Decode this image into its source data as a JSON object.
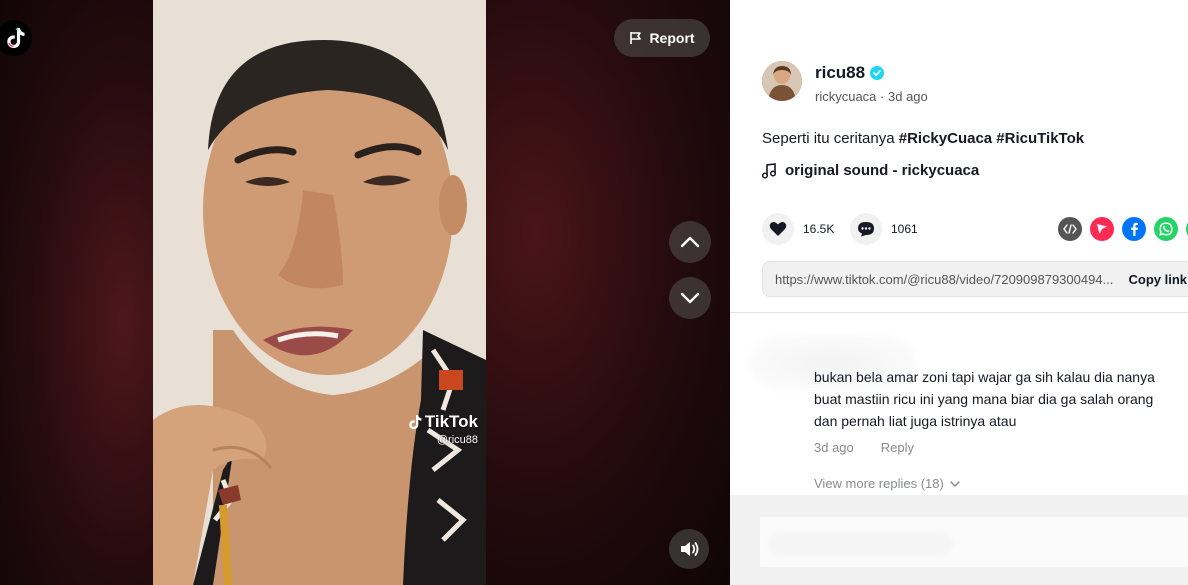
{
  "video": {
    "report_label": "Report",
    "watermark_brand": "TikTok",
    "watermark_handle": "@ricu88"
  },
  "author": {
    "username": "ricu88",
    "nickname": "rickycuaca",
    "posted": "3d ago"
  },
  "post": {
    "caption_text": "Seperti itu ceritanya",
    "caption_tags": "#RickyCuaca #RicuTikTok",
    "sound": "original sound - rickycuaca",
    "likes": "16.5K",
    "comments": "1061",
    "link": "https://www.tiktok.com/@ricu88/video/720909879300494...",
    "copy_label": "Copy link"
  },
  "comment": {
    "text": "bukan bela amar zoni tapi wajar ga sih kalau dia nanya buat mastiin ricu ini yang mana biar dia ga salah orang dan pernah liat juga istrinya atau",
    "time": "3d ago",
    "reply_label": "Reply",
    "more_replies": "View more replies (18)"
  },
  "share_icons": [
    "embed-icon",
    "send-icon",
    "facebook-icon",
    "whatsapp-icon"
  ],
  "colors": {
    "verified": "#20d5ec",
    "send": "#fe2c55",
    "facebook": "#0075fa",
    "whatsapp": "#25d366"
  }
}
